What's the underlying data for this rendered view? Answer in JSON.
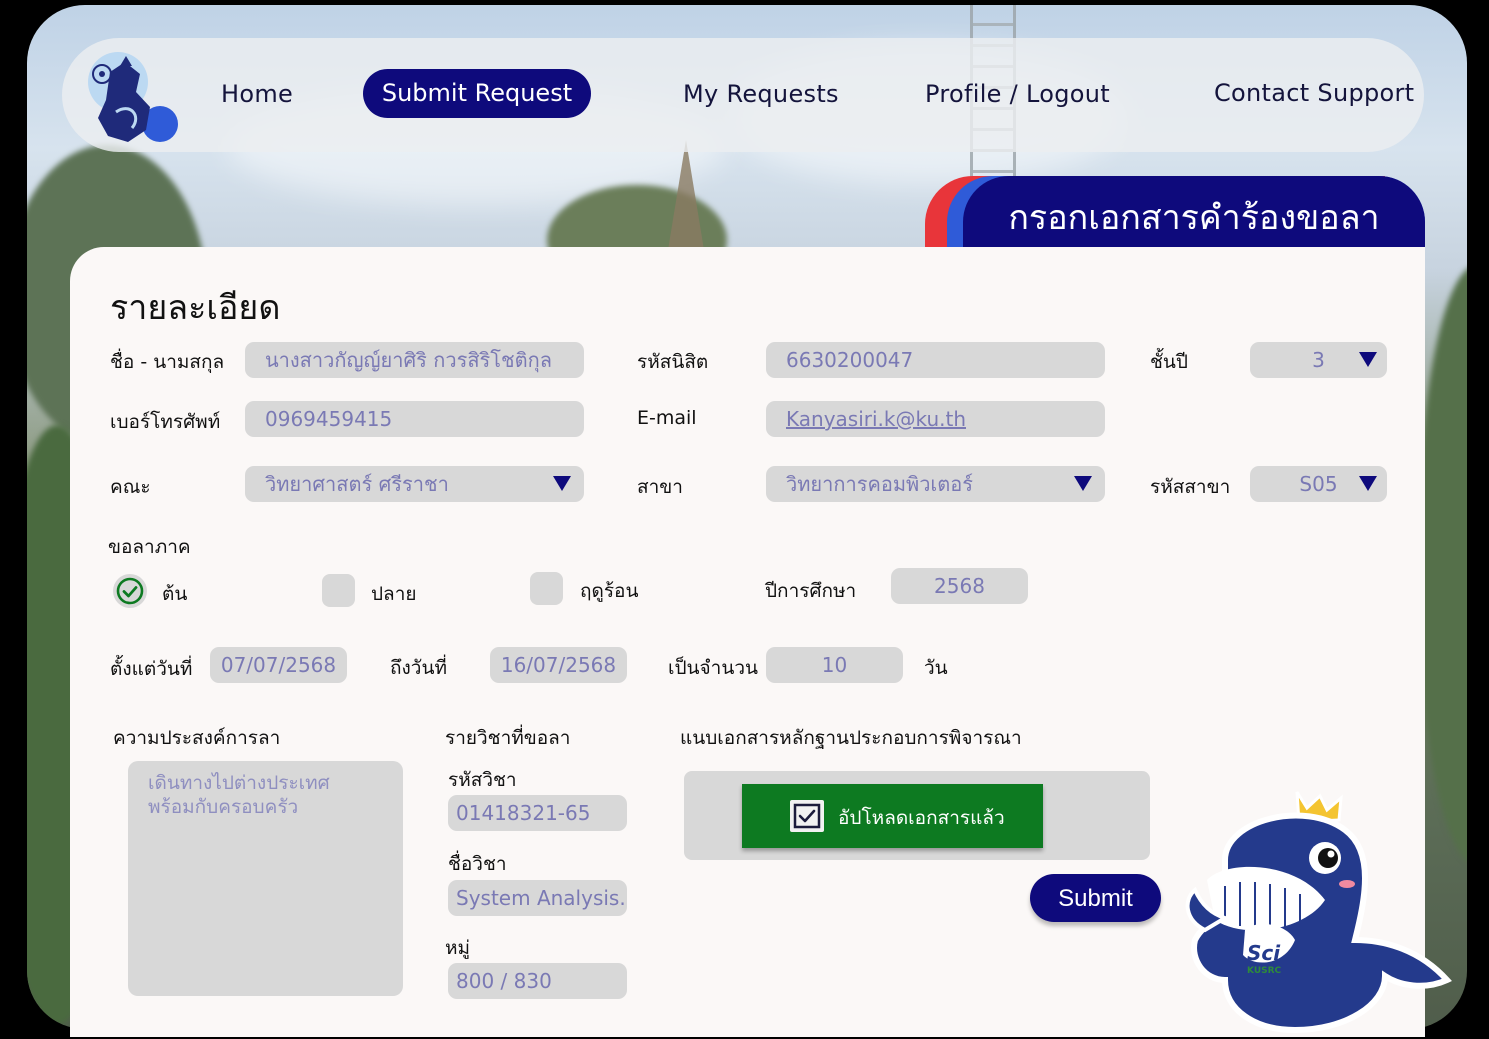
{
  "nav": {
    "home": "Home",
    "submit_request": "Submit Request",
    "my_requests": "My Requests",
    "profile_logout": "Profile / Logout",
    "contact_support": "Contact Support"
  },
  "page_title": "กรอกเอกสารคำร้องขอลา",
  "section_heading": "รายละเอียด",
  "form": {
    "name_label": "ชื่อ - นามสกุล",
    "name_value": "นางสาวกัญญ์ยาศิริ  กวรสิริโชติกุล",
    "student_id_label": "รหัสนิสิต",
    "student_id_value": "6630200047",
    "year_label": "ชั้นปี",
    "year_value": "3",
    "phone_label": "เบอร์โทรศัพท์",
    "phone_value": "0969459415",
    "email_label": "E-mail",
    "email_value": "Kanyasiri.k@ku.th",
    "faculty_label": "คณะ",
    "faculty_value": "วิทยาศาสตร์ ศรีราชา",
    "major_label": "สาขา",
    "major_value": "วิทยาการคอมพิวเตอร์",
    "major_code_label": "รหัสสาขา",
    "major_code_value": "S05",
    "semester_label": "ขอลาภาค",
    "semester_options": [
      "ต้น",
      "ปลาย",
      "ฤดูร้อน"
    ],
    "semester_selected": "ต้น",
    "academic_year_label": "ปีการศึกษา",
    "academic_year_value": "2568",
    "from_date_label": "ตั้งแต่วันที่",
    "from_date_value": "07/07/2568",
    "to_date_label": "ถึงวันที่",
    "to_date_value": "16/07/2568",
    "count_label": "เป็นจำนวน",
    "count_value": "10",
    "count_unit": "วัน",
    "purpose_label": "ความประสงค์การลา",
    "purpose_value": "เดินทางไปต่างประเทศ\nพร้อมกับครอบครัว",
    "courses_label": "รายวิชาที่ขอลา",
    "course_code_label": "รหัสวิชา",
    "course_code_value": "01418321-65",
    "course_name_label": "ชื่อวิชา",
    "course_name_value": "System Analysis..",
    "section_label": "หมู่",
    "section_value": "800 / 830",
    "attach_label": "แนบเอกสารหลักฐานประกอบการพิจารณา",
    "upload_status": "อัปโหลดเอกสารแล้ว",
    "submit_label": "Submit"
  },
  "colors": {
    "navy": "#0e0a7c",
    "field_bg": "#d8d8d8",
    "field_text": "#7a79b4",
    "upload_green": "#0d7a21",
    "tab_red": "#e8353a",
    "tab_blue": "#2f5bd8"
  },
  "mascot_text": "Sci KUSRC"
}
